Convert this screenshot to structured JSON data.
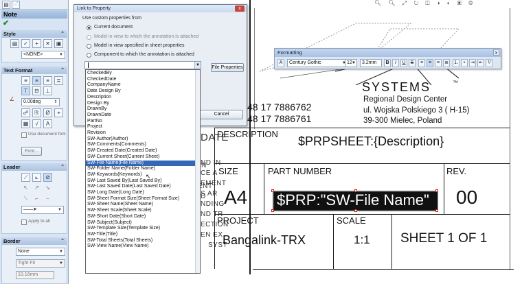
{
  "property_manager": {
    "title": "Note",
    "ok_symbol": "✔",
    "tabs": [
      "▤",
      "📄"
    ],
    "sections": {
      "style": "Style",
      "text_format": "Text Format",
      "leader": "Leader",
      "border": "Border"
    },
    "style_select": "<NONE>",
    "angle_value": "0.00deg",
    "use_document_font_label": "Use document font",
    "font_button": "Font...",
    "apply_to_all_label": "Apply to all",
    "border_select": "None",
    "border_size_select": "Tight Fit",
    "border_dim": "10.16mm"
  },
  "dialog": {
    "title": "Link to Property",
    "close_symbol": "x",
    "group_label": "Use custom properties from",
    "radio_options": [
      {
        "label": "Current document",
        "selected": true,
        "disabled": false
      },
      {
        "label": "Model in view to which the annotation is attached",
        "selected": false,
        "disabled": true
      },
      {
        "label": "Model in view specified in sheet properties",
        "selected": false,
        "disabled": false
      },
      {
        "label": "Component to which the annotation is attached",
        "selected": false,
        "disabled": false
      }
    ],
    "file_properties_button": "File Properties",
    "cancel_button": "Cancel",
    "combo_value": "",
    "property_list": [
      "CheckedBy",
      "CheckedDate",
      "CompanyName",
      "Date Design By",
      "Description",
      "Design By",
      "DrawnBy",
      "DrawnDate",
      "PartNo",
      "Project",
      "Revision",
      "SW-Author(Author)",
      "SW-Comments(Comments)",
      "SW-Created Date(Created Date)",
      "SW-Current Sheet(Current Sheet)",
      "SW-File Name(File Name)",
      "SW-Folder Name(Folder Name)",
      "SW-Keywords(Keywords)",
      "SW-Last Saved By(Last Saved By)",
      "SW-Last Saved Date(Last Saved Date)",
      "SW-Long Date(Long Date)",
      "SW-Sheet Format Size(Sheet Format Size)",
      "SW-Sheet Name(Sheet Name)",
      "SW-Sheet Scale(Sheet Scale)",
      "SW-Short Date(Short Date)",
      "SW-Subject(Subject)",
      "SW-Template Size(Template Size)",
      "SW-Title(Title)",
      "SW-Total Sheets(Total Sheets)",
      "SW-View Name(View Name)"
    ],
    "highlighted_index": 15
  },
  "formatting": {
    "title": "Formatting",
    "close_symbol": "x",
    "font": "Century Gothic",
    "size": "12",
    "height": "3.2mm"
  },
  "drawing": {
    "phone1": "48 17 7886762",
    "phone2": "48 17 7886761",
    "systems": "SYSTEMS",
    "tm": "™",
    "addr1": "Regional Design Center",
    "addr2": "ul. Wojska Polskiego 3 ( H-15)",
    "addr3": "39-300 Mielec, Poland",
    "desc_label": "DESCRIPTION",
    "desc_value": "$PRPSHEET:{Description}",
    "size_label": "SIZE",
    "size_value": "A4",
    "partnum_label": "PART NUMBER",
    "partnum_value": "$PRP:\"SW-File Name\"",
    "rev_label": "REV.",
    "rev_value": "00",
    "project_label": "PROJECT",
    "project_value": "Bangalink-TRX",
    "scale_label": "SCALE",
    "scale_value": "1:1",
    "sheet_value": "SHEET 1 OF 1",
    "partial_left": [
      "DATE",
      "ND IN",
      "CE A",
      "EMENT",
      "S AR",
      "NDING",
      "ND TR",
      "ECTION",
      "EN EX",
      "SYST"
    ],
    "partial_right": [
      "N",
      "ENT",
      "D"
    ]
  }
}
